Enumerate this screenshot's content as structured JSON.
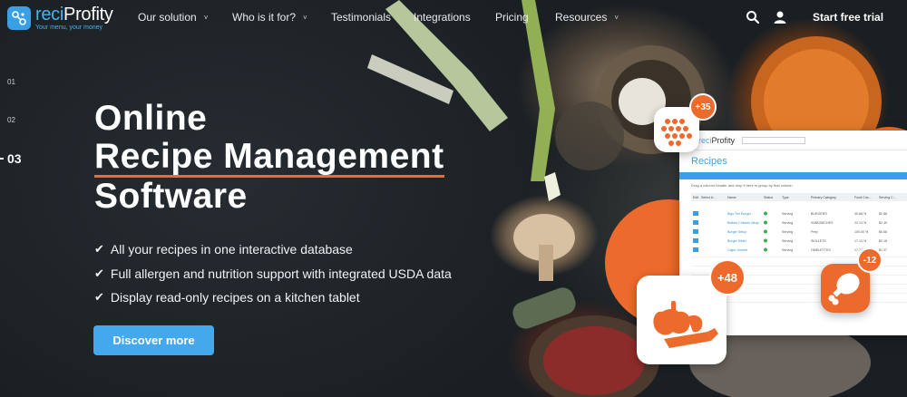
{
  "brand": {
    "name_prefix": "reci",
    "name_suffix": "Profity",
    "tagline": "Your menu, your money"
  },
  "nav": {
    "items": [
      {
        "label": "Our solution",
        "has_dropdown": true
      },
      {
        "label": "Who is it for?",
        "has_dropdown": true
      },
      {
        "label": "Testimonials",
        "has_dropdown": false
      },
      {
        "label": "Integrations",
        "has_dropdown": false
      },
      {
        "label": "Pricing",
        "has_dropdown": false
      },
      {
        "label": "Resources",
        "has_dropdown": true
      }
    ],
    "caret": "˅",
    "cta": "Start free trial",
    "icons": [
      "search-icon",
      "user-icon"
    ]
  },
  "slides": {
    "items": [
      "01",
      "02",
      "03"
    ],
    "active": "03"
  },
  "hero": {
    "title_line1": "Online",
    "title_line2": "Recipe Management",
    "title_line3": "Software",
    "bullets": [
      "All your recipes in one interactive database",
      "Full allergen and nutrition support with integrated USDA data",
      "Display read-only recipes on a kitchen tablet"
    ],
    "button": "Discover more"
  },
  "badges": {
    "top": "+35",
    "left": "+48",
    "right": "-12"
  },
  "app": {
    "logo_prefix": "reci",
    "logo_suffix": "Profity",
    "heading": "Recipes",
    "group_hint": "Drag a column header and drop it here to group by that column",
    "columns": [
      "Edit",
      "Select A...",
      "Name",
      "Status",
      "Type",
      "Primary Category",
      "Food Cos...",
      "Serving C..."
    ],
    "rows": [
      [
        "Bigs The Burger",
        "Serving",
        "BURGERS",
        "40.88 %",
        "$2.88"
      ],
      [
        "Buffalo Chicken Wrap",
        "Serving",
        "SANDWICHES",
        "22.13 %",
        "$2.40"
      ],
      [
        "Burger Setup",
        "Serving",
        "Prep",
        "100.00 %",
        "$0.66"
      ],
      [
        "Burger Slider",
        "Serving",
        "SKILLETS",
        "17.13 %",
        "$2.18"
      ],
      [
        "Cajun Omelet",
        "Serving",
        "OMELETTES",
        "17.71 %",
        "$1.37"
      ]
    ]
  },
  "colors": {
    "accent": "#ec6a2c",
    "primary": "#44a9ec",
    "background": "#1c2126"
  }
}
